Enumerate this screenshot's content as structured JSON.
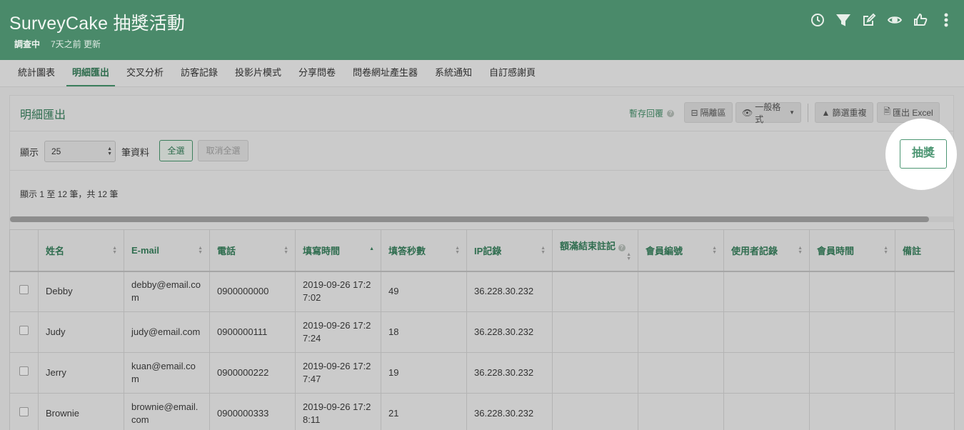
{
  "header": {
    "title": "SurveyCake 抽獎活動",
    "status": "調查中",
    "updated": "7天之前 更新",
    "icons": [
      "clock-icon",
      "filter-icon",
      "edit-icon",
      "eye-icon",
      "thumbs-up-icon",
      "more-vertical-icon"
    ]
  },
  "tabs": [
    {
      "label": "統計圖表",
      "active": false
    },
    {
      "label": "明細匯出",
      "active": true
    },
    {
      "label": "交叉分析",
      "active": false
    },
    {
      "label": "訪客記錄",
      "active": false
    },
    {
      "label": "投影片模式",
      "active": false
    },
    {
      "label": "分享問卷",
      "active": false
    },
    {
      "label": "問卷網址產生器",
      "active": false
    },
    {
      "label": "系統通知",
      "active": false
    },
    {
      "label": "自訂感謝頁",
      "active": false
    }
  ],
  "panel": {
    "title": "明細匯出",
    "save_reply": "暫存回覆",
    "isolate": "隔離區",
    "format": "一般格式",
    "dedupe": "篩選重複",
    "export_excel": "匯出 Excel",
    "show_label": "顯示",
    "page_size": "25",
    "records_label": "筆資料",
    "select_all": "全選",
    "deselect_all": "取消全選",
    "info": "顯示 1 至 12 筆，共 12 筆",
    "draw": "抽獎"
  },
  "table": {
    "columns": [
      "姓名",
      "E-mail",
      "電話",
      "填寫時間",
      "填答秒數",
      "IP記錄",
      "額滿結束註記",
      "會員編號",
      "使用者記錄",
      "會員時間",
      "備註"
    ],
    "rows": [
      {
        "name": "Debby",
        "email": "debby@email.com",
        "phone": "0900000000",
        "time": "2019-09-26 17:27:02",
        "seconds": "49",
        "ip": "36.228.30.232"
      },
      {
        "name": "Judy",
        "email": "judy@email.com",
        "phone": "0900000111",
        "time": "2019-09-26 17:27:24",
        "seconds": "18",
        "ip": "36.228.30.232"
      },
      {
        "name": "Jerry",
        "email": "kuan@email.com",
        "phone": "0900000222",
        "time": "2019-09-26 17:27:47",
        "seconds": "19",
        "ip": "36.228.30.232"
      },
      {
        "name": "Brownie",
        "email": "brownie@email.com",
        "phone": "0900000333",
        "time": "2019-09-26 17:28:11",
        "seconds": "21",
        "ip": "36.228.30.232"
      }
    ]
  },
  "colors": {
    "header_bg": "#4a8a6a",
    "accent": "#2f6d4f",
    "draw_button": "#4d9673"
  }
}
